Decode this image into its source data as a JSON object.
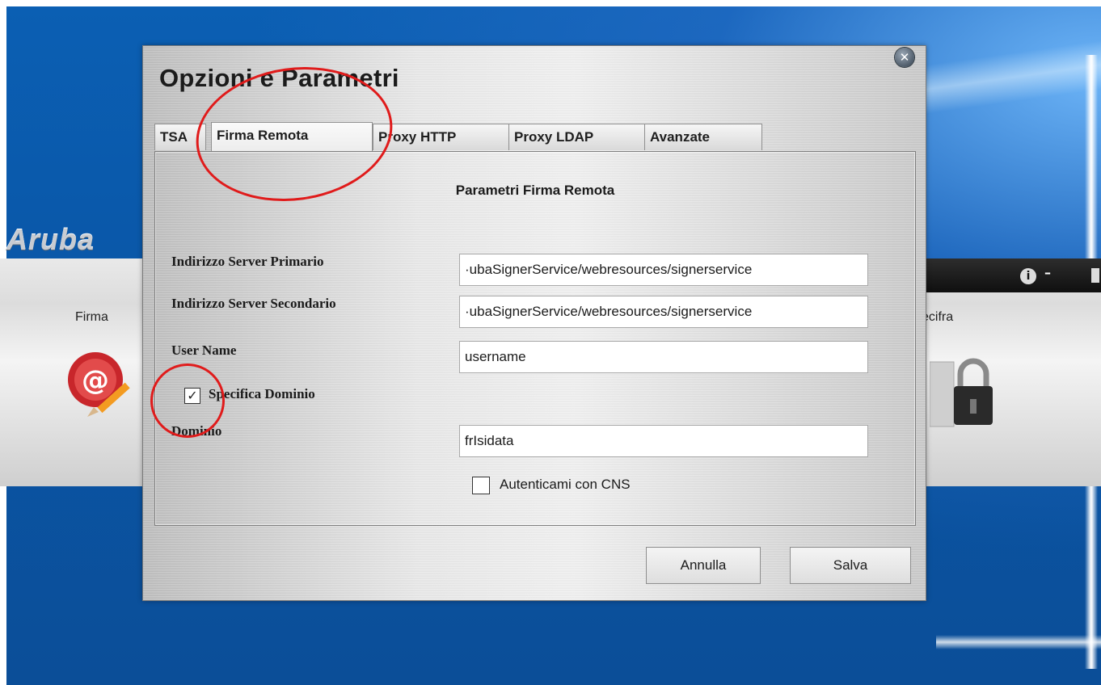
{
  "dialog": {
    "title": "Opzioni e Parametri",
    "close_icon": "close-icon"
  },
  "tabs": [
    {
      "label": "TSA",
      "active": false
    },
    {
      "label": "Firma Remota",
      "active": true
    },
    {
      "label": "Proxy HTTP",
      "active": false
    },
    {
      "label": "Proxy LDAP",
      "active": false
    },
    {
      "label": "Avanzate",
      "active": false
    }
  ],
  "panel": {
    "title": "Parametri Firma Remota",
    "fields": {
      "primary_label": "Indirizzo Server Primario",
      "primary_value": "·ubaSignerService/webresources/signerservice",
      "secondary_label": "Indirizzo Server Secondario",
      "secondary_value": "·ubaSignerService/webresources/signerservice",
      "username_label": "User Name",
      "username_value": "username",
      "specifica_label": "Specifica Dominio",
      "specifica_checked": true,
      "dominio_label": "Dominio",
      "dominio_value": "frIsidata",
      "cns_label": "Autenticami con CNS",
      "cns_checked": false
    }
  },
  "buttons": {
    "annulla": "Annulla",
    "salva": "Salva"
  },
  "background_app": {
    "logo": "Aruba",
    "firma_label": "Firma",
    "decifra_label": "ecifra",
    "controls": {
      "info": "i",
      "minimize": "–"
    }
  },
  "colors": {
    "annotation": "#e01b1b",
    "desktop": "#0b5fb3"
  }
}
